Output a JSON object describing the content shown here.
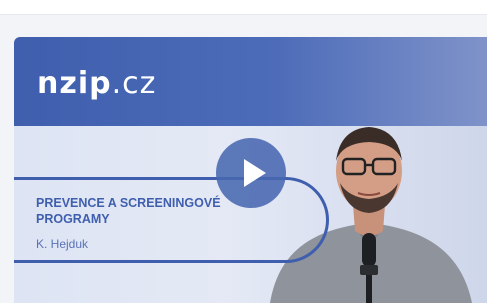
{
  "video_card": {
    "logo": {
      "brand": "nzip",
      "tld": ".cz"
    },
    "title": "PREVENCE A SCREENINGOVÉ PROGRAMY",
    "author": "K. Hejduk",
    "colors": {
      "primary_blue": "#3f5fae",
      "light_background": "#dfe5f2"
    },
    "play_icon": "play-icon"
  }
}
